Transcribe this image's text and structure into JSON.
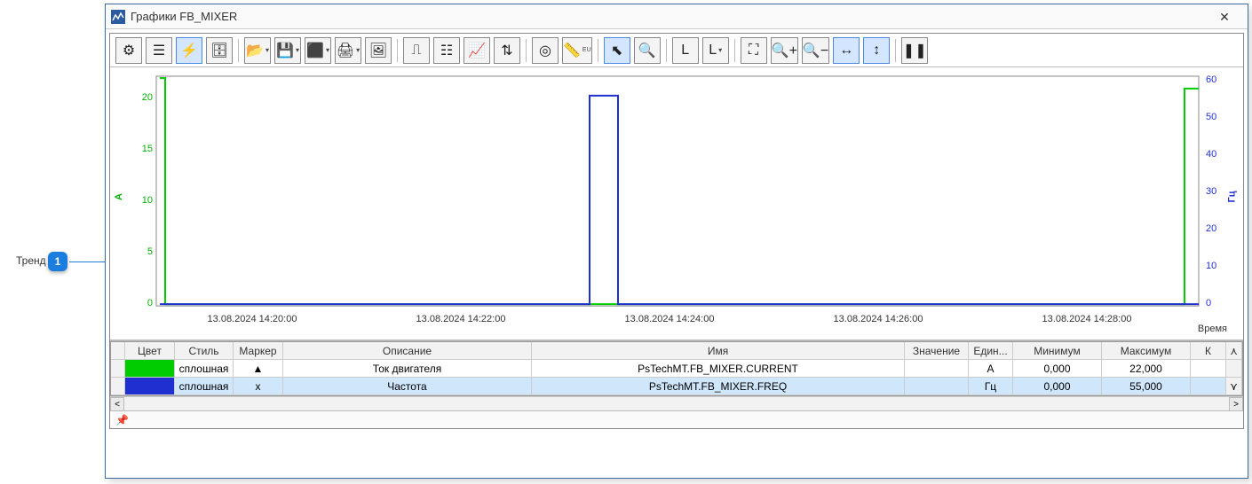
{
  "annotation": {
    "label": "Тренд",
    "number": "1"
  },
  "window": {
    "title": "Графики FB_MIXER",
    "close_glyph": "✕"
  },
  "toolbar": {
    "gear": "⚙",
    "link": "☰",
    "bolt": "⚡",
    "db": "🗄",
    "open": "📂",
    "save": "💾",
    "excel": "⬛",
    "print": "🖨",
    "image": "🖼",
    "osc": "⎍",
    "list": "☷",
    "line": "📈",
    "scale": "⇅",
    "target": "◎",
    "ruler": "📏",
    "pointer": "⬉",
    "zoom": "🔍",
    "lb": "L",
    "lbarr": "L",
    "fit": "⛶",
    "zoomin": "🔍+",
    "zoomout": "🔍−",
    "harrow": "↔",
    "varrow": "↕",
    "pause": "❚❚",
    "eu": "EU"
  },
  "chart": {
    "xlabel": "Время",
    "y_left_label": "A",
    "y_right_label": "Гц",
    "left_ticks": [
      "0",
      "5",
      "10",
      "15",
      "20"
    ],
    "right_ticks": [
      "0",
      "10",
      "20",
      "30",
      "40",
      "50",
      "60"
    ],
    "x_ticks": [
      "13.08.2024 14:20:00",
      "13.08.2024 14:22:00",
      "13.08.2024 14:24:00",
      "13.08.2024 14:26:00",
      "13.08.2024 14:28:00"
    ]
  },
  "chart_data": {
    "type": "line",
    "x_range": [
      "13.08.2024 14:19:00",
      "13.08.2024 14:29:30"
    ],
    "xlabel": "Время",
    "series": [
      {
        "name": "PsTechMT.FB_MIXER.CURRENT",
        "label": "Ток двигателя",
        "unit": "A",
        "color": "#00cc00",
        "axis": "left",
        "y_range": [
          0,
          22
        ],
        "segments": [
          {
            "from": "14:19:00",
            "to": "14:19:20",
            "value": 22
          },
          {
            "from": "14:19:20",
            "to": "14:29:20",
            "value": 0
          },
          {
            "from": "14:29:20",
            "to": "14:29:30",
            "value": 22
          }
        ]
      },
      {
        "name": "PsTechMT.FB_MIXER.FREQ",
        "label": "Частота",
        "unit": "Гц",
        "color": "#2030d0",
        "axis": "right",
        "y_range": [
          0,
          60
        ],
        "segments": [
          {
            "from": "14:19:00",
            "to": "14:23:25",
            "value": 0
          },
          {
            "from": "14:23:25",
            "to": "14:23:45",
            "value": 55
          },
          {
            "from": "14:23:45",
            "to": "14:29:30",
            "value": 0
          }
        ]
      }
    ]
  },
  "legend": {
    "headers": {
      "color": "Цвет",
      "style": "Стиль",
      "marker": "Маркер",
      "desc": "Описание",
      "name": "Имя",
      "value": "Значение",
      "unit": "Един...",
      "min": "Минимум",
      "max": "Максимум",
      "k": "К"
    },
    "rows": [
      {
        "style": "сплошная",
        "marker": "▲",
        "desc": "Ток двигателя",
        "name": "PsTechMT.FB_MIXER.CURRENT",
        "value": "",
        "unit": "A",
        "min": "0,000",
        "max": "22,000"
      },
      {
        "style": "сплошная",
        "marker": "x",
        "desc": "Частота",
        "name": "PsTechMT.FB_MIXER.FREQ",
        "value": "",
        "unit": "Гц",
        "min": "0,000",
        "max": "55,000"
      }
    ],
    "scroll_up": "⋏",
    "scroll_down": "⋎",
    "scroll_right": ">",
    "scroll_left": "<"
  },
  "status": {
    "pin": "📌"
  }
}
